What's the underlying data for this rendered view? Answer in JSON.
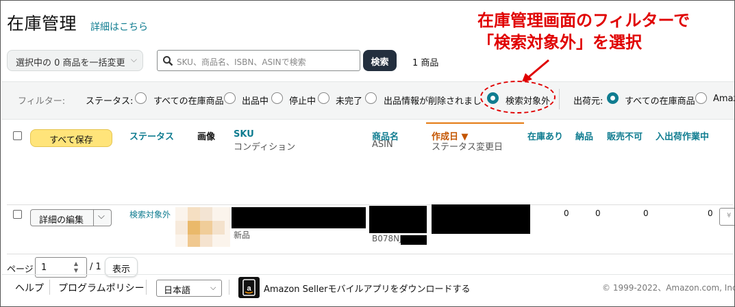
{
  "header": {
    "title": "在庫管理",
    "help_link": "詳細はこちら"
  },
  "toolbar": {
    "bulk_action": "選択中の 0 商品を一括変更",
    "search_placeholder": "SKU、商品名、ISBN、ASINで検索",
    "search_button": "検索",
    "result_count": "1 商品"
  },
  "filters": {
    "label": "フィルター:",
    "status_label": "ステータス:",
    "status_options": [
      "すべての在庫商品",
      "出品中",
      "停止中",
      "未完了",
      "出品情報が削除されました",
      "検索対象外"
    ],
    "status_selected": "検索対象外",
    "fulfillment_label": "出荷元:",
    "fulfillment_options": [
      "すべての在庫商品",
      "Amaz"
    ],
    "fulfillment_selected": "すべての在庫商品"
  },
  "annotation": {
    "line1": "在庫管理画面のフィルターで",
    "line2": "「検索対象外」を選択",
    "color": "#e00000"
  },
  "table": {
    "save_all": "すべて保存",
    "columns": {
      "status": "ステータス",
      "image": "画像",
      "sku": "SKU",
      "sku_sub": "コンディション",
      "name": "商品名",
      "name_sub": "ASIN",
      "created": "作成日 ▼",
      "created_sub": "ステータス変更日",
      "in_stock": "在庫あり",
      "inbound": "納品",
      "unsellable": "販売不可",
      "inbound_work": "入出荷作業中"
    },
    "rows": [
      {
        "edit_button": "詳細の編集",
        "status": "検索対象外",
        "condition": "新品",
        "asin_visible": "B078NJ",
        "in_stock": "0",
        "inbound": "0",
        "unsellable": "0",
        "inbound_work": "0",
        "price_placeholder": "¥"
      }
    ]
  },
  "pagination": {
    "label": "ページ",
    "current": "1",
    "total": "/ 1",
    "show_button": "表示"
  },
  "footer": {
    "help": "ヘルプ",
    "policy": "プログラムポリシー",
    "language": "日本語",
    "app_promo": "Amazon Sellerモバイルアプリをダウンロードする",
    "copyright": "© 1999-2022、Amazon.com, Inc"
  },
  "colors": {
    "accent": "#0f7c90",
    "sort": "#e47911",
    "save_button": "#ffe47a",
    "search_button": "#232f3e"
  }
}
